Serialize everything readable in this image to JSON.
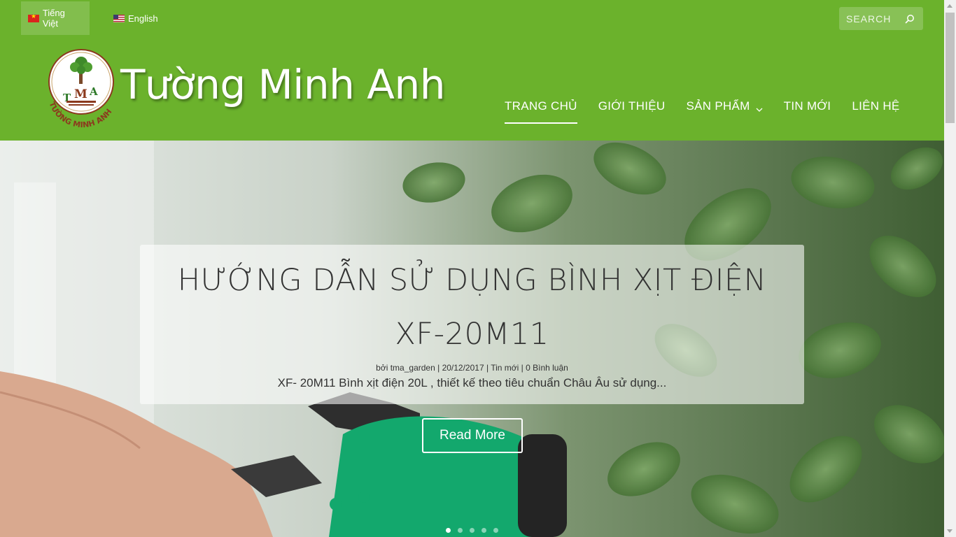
{
  "languages": [
    {
      "label": "Tiếng Việt",
      "flag": "vietnam-flag-icon",
      "active": true
    },
    {
      "label": "English",
      "flag": "us-flag-icon",
      "active": false
    }
  ],
  "search": {
    "placeholder": "SEARCH",
    "icon": "search-icon"
  },
  "brand": {
    "name": "Tường Minh Anh",
    "logo_letters": "TMA",
    "logo_ring_text": "TƯỜNG MINH ANH"
  },
  "nav": {
    "items": [
      {
        "label": "TRANG CHỦ",
        "active": true
      },
      {
        "label": "GIỚI THIỆU"
      },
      {
        "label": "SẢN PHẨM",
        "has_dropdown": true
      },
      {
        "label": "TIN MỚI"
      },
      {
        "label": "LIÊN HỆ"
      }
    ]
  },
  "hero": {
    "title": "HƯỚNG DẪN SỬ DỤNG BÌNH XỊT ĐIỆN XF-20M11",
    "meta": {
      "author": "bởi tma_garden",
      "date": "20/12/2017",
      "category": "Tin mới",
      "comments": "0 Bình luận"
    },
    "excerpt": "XF- 20M11 Bình xịt điện 20L , thiết kế theo tiêu chuẩn Châu Âu sử dụng...",
    "read_more": "Read More",
    "slides_count": 5,
    "active_slide": 0
  },
  "colors": {
    "header_bg": "#6bb22c",
    "white": "#ffffff",
    "text_dark": "#333333"
  }
}
